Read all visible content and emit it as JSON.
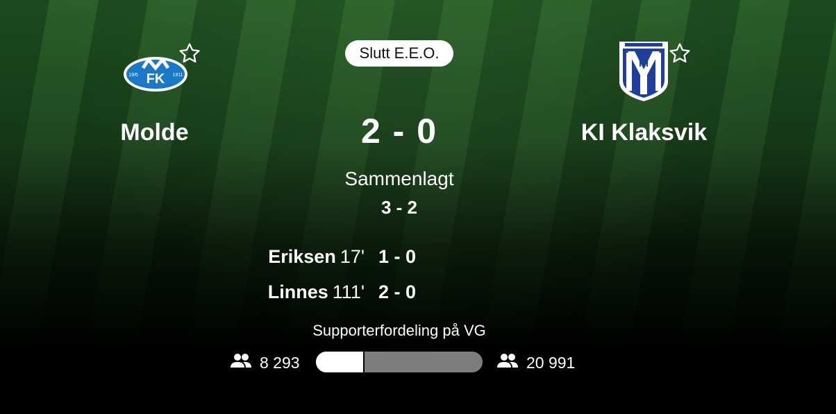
{
  "match": {
    "status": "Slutt E.E.O.",
    "score": "2 - 0",
    "aggregate_label": "Sammenlagt",
    "aggregate_score": "3 - 2"
  },
  "home": {
    "name": "Molde",
    "logo_text": "FK",
    "logo_years_left": "19/6",
    "logo_years_right": "1911"
  },
  "away": {
    "name": "KI Klaksvik",
    "logo_text": "KI"
  },
  "goals": [
    {
      "player": "Eriksen",
      "minute": "17'",
      "score": "1 - 0"
    },
    {
      "player": "Linnes",
      "minute": "111'",
      "score": "2 - 0"
    }
  ],
  "supporters": {
    "title": "Supporterfordeling på VG",
    "home_count": "8 293",
    "away_count": "20 991",
    "home_fraction": 0.283
  },
  "icons": {
    "favorite": "star-outline-icon",
    "people": "people-icon"
  },
  "colors": {
    "molde_blue": "#1a78c8",
    "ki_blue": "#1f3f9c",
    "bar_home": "#ffffff",
    "bar_away": "#7d7d7d"
  }
}
